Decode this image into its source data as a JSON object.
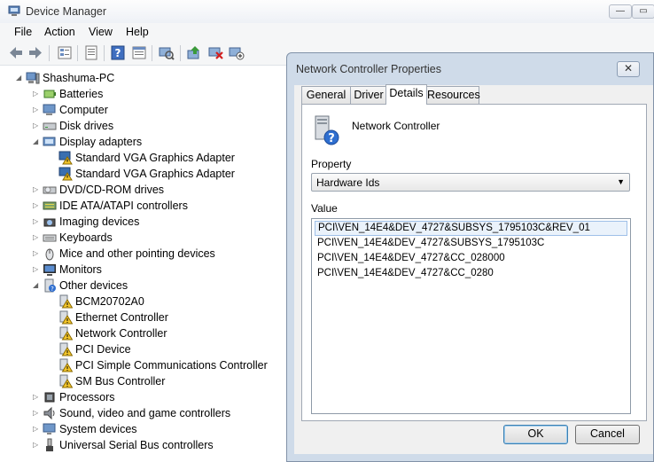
{
  "window": {
    "title": "Device Manager",
    "controls": {
      "minimize": "—",
      "maximize": "▭"
    }
  },
  "menu": [
    "File",
    "Action",
    "View",
    "Help"
  ],
  "tree": {
    "root": "Shashuma-PC",
    "items": [
      {
        "label": "Batteries",
        "icon": "battery-icon",
        "expanded": false
      },
      {
        "label": "Computer",
        "icon": "computer-icon",
        "expanded": false
      },
      {
        "label": "Disk drives",
        "icon": "disk-drive-icon",
        "expanded": false
      },
      {
        "label": "Display adapters",
        "icon": "display-adapter-icon",
        "expanded": true
      },
      {
        "label": "Standard VGA Graphics Adapter",
        "icon": "warning-display-icon",
        "child": true
      },
      {
        "label": "Standard VGA Graphics Adapter",
        "icon": "warning-display-icon",
        "child": true
      },
      {
        "label": "DVD/CD-ROM drives",
        "icon": "dvd-drive-icon",
        "expanded": false
      },
      {
        "label": "IDE ATA/ATAPI controllers",
        "icon": "ide-controller-icon",
        "expanded": false
      },
      {
        "label": "Imaging devices",
        "icon": "camera-icon",
        "expanded": false
      },
      {
        "label": "Keyboards",
        "icon": "keyboard-icon",
        "expanded": false
      },
      {
        "label": "Mice and other pointing devices",
        "icon": "mouse-icon",
        "expanded": false
      },
      {
        "label": "Monitors",
        "icon": "monitor-icon",
        "expanded": false
      },
      {
        "label": "Other devices",
        "icon": "unknown-device-icon",
        "expanded": true
      },
      {
        "label": "BCM20702A0",
        "icon": "warning-device-icon",
        "child": true
      },
      {
        "label": "Ethernet Controller",
        "icon": "warning-device-icon",
        "child": true
      },
      {
        "label": "Network Controller",
        "icon": "warning-device-icon",
        "child": true
      },
      {
        "label": "PCI Device",
        "icon": "warning-device-icon",
        "child": true
      },
      {
        "label": "PCI Simple Communications Controller",
        "icon": "warning-device-icon",
        "child": true
      },
      {
        "label": "SM Bus Controller",
        "icon": "warning-device-icon",
        "child": true
      },
      {
        "label": "Processors",
        "icon": "processor-icon",
        "expanded": false
      },
      {
        "label": "Sound, video and game controllers",
        "icon": "speaker-icon",
        "expanded": false
      },
      {
        "label": "System devices",
        "icon": "system-device-icon",
        "expanded": false
      },
      {
        "label": "Universal Serial Bus controllers",
        "icon": "usb-icon",
        "expanded": false
      }
    ]
  },
  "dialog": {
    "title": "Network Controller Properties",
    "close": "✕",
    "tabs": [
      "General",
      "Driver",
      "Details",
      "Resources"
    ],
    "active_tab": "Details",
    "device_name": "Network Controller",
    "property_label": "Property",
    "property_value": "Hardware Ids",
    "value_label": "Value",
    "values": [
      "PCI\\VEN_14E4&DEV_4727&SUBSYS_1795103C&REV_01",
      "PCI\\VEN_14E4&DEV_4727&SUBSYS_1795103C",
      "PCI\\VEN_14E4&DEV_4727&CC_028000",
      "PCI\\VEN_14E4&DEV_4727&CC_0280"
    ],
    "ok_label": "OK",
    "cancel_label": "Cancel"
  },
  "colors": {
    "dialog_frame": "#cfdbe9",
    "selection_bg": "#eaf2fb",
    "warning_yellow": "#f3c62b"
  }
}
